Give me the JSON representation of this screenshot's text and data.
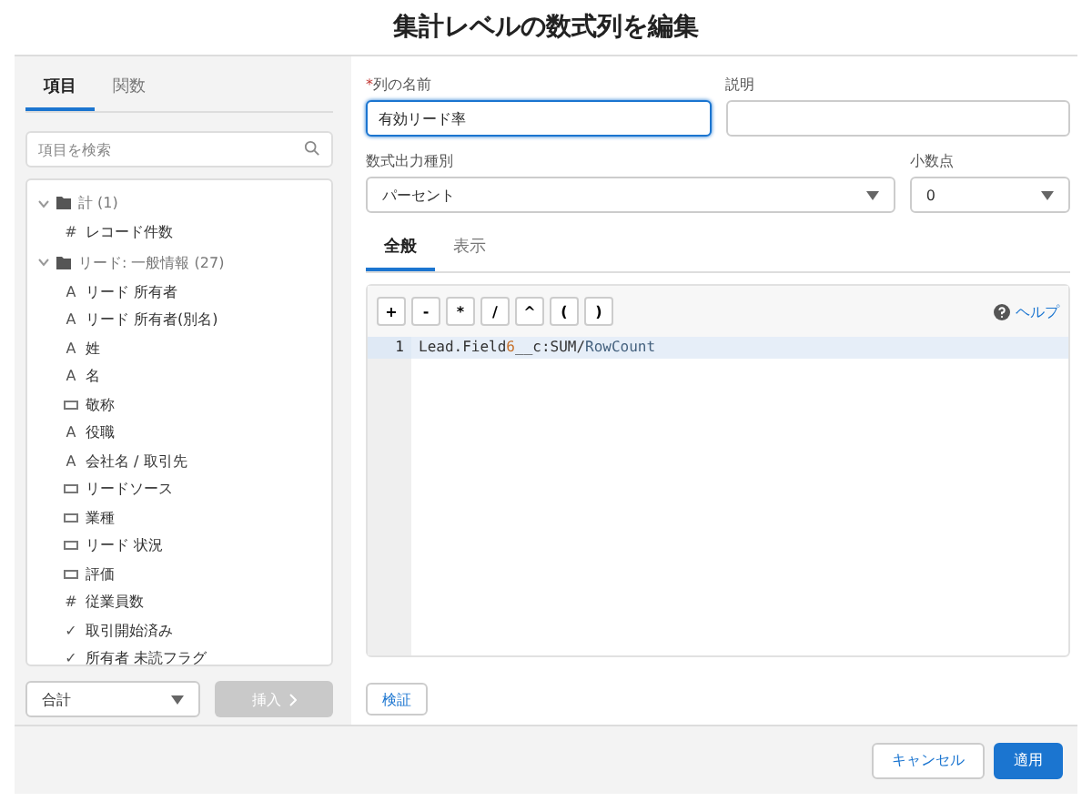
{
  "window": {
    "title": "集計レベルの数式列を編集"
  },
  "left_tabs": [
    {
      "label": "項目",
      "selected": true
    },
    {
      "label": "関数",
      "selected": false
    }
  ],
  "search": {
    "placeholder": "項目を検索"
  },
  "tree": [
    {
      "label": "計 (1)",
      "expanded": true,
      "children": [
        {
          "kind": "glyph",
          "symbol": "#",
          "label": "レコード件数"
        }
      ]
    },
    {
      "label": "リード: 一般情報 (27)",
      "expanded": true,
      "children": [
        {
          "kind": "glyph",
          "symbol": "A",
          "label": "リード 所有者"
        },
        {
          "kind": "glyph",
          "symbol": "A",
          "label": "リード 所有者(別名)"
        },
        {
          "kind": "glyph",
          "symbol": "A",
          "label": "姓"
        },
        {
          "kind": "glyph",
          "symbol": "A",
          "label": "名"
        },
        {
          "kind": "picklist",
          "label": "敬称"
        },
        {
          "kind": "glyph",
          "symbol": "A",
          "label": "役職"
        },
        {
          "kind": "glyph",
          "symbol": "A",
          "label": "会社名 / 取引先"
        },
        {
          "kind": "picklist",
          "label": "リードソース"
        },
        {
          "kind": "picklist",
          "label": "業種"
        },
        {
          "kind": "picklist",
          "label": "リード 状況"
        },
        {
          "kind": "picklist",
          "label": "評価"
        },
        {
          "kind": "glyph",
          "symbol": "#",
          "label": "従業員数"
        },
        {
          "kind": "glyph",
          "symbol": "✓",
          "label": "取引開始済み"
        },
        {
          "kind": "glyph",
          "symbol": "✓",
          "label": "所有者 未読フラグ"
        }
      ]
    }
  ],
  "summary_select": {
    "value": "合計"
  },
  "insert_button": {
    "label": "挿入",
    "disabled": true
  },
  "column_name": {
    "label": "列の名前",
    "required": true,
    "value": "有効リード率"
  },
  "description": {
    "label": "説明"
  },
  "output_type": {
    "label": "数式出力種別",
    "value": "パーセント"
  },
  "decimals": {
    "label": "小数点",
    "value": "0"
  },
  "editor_tabs": [
    {
      "label": "全般",
      "selected": true
    },
    {
      "label": "表示",
      "selected": false
    }
  ],
  "operators": [
    "+",
    "-",
    "*",
    "/",
    "^",
    "(",
    ")"
  ],
  "help_link": "ヘルプ",
  "code_lines": [
    {
      "number": "1",
      "tokens": [
        {
          "kind": "ident",
          "text": "Lead.Field"
        },
        {
          "kind": "number",
          "text": "6"
        },
        {
          "kind": "ident",
          "text": "__c:SUM/"
        },
        {
          "kind": "field",
          "text": "RowCount"
        }
      ]
    }
  ],
  "verify_button": "検証",
  "footer": {
    "cancel": "キャンセル",
    "apply": "適用"
  }
}
